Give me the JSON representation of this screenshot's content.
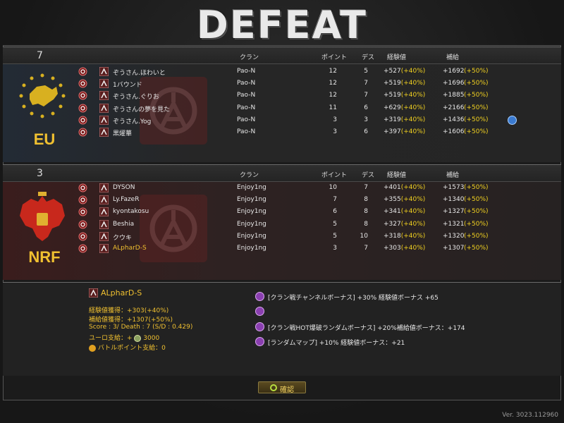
{
  "result_title": "DEFEAT",
  "headers": {
    "clan": "クラン",
    "points": "ポイント",
    "deaths": "デス",
    "exp": "経験値",
    "supply": "補給"
  },
  "teams": [
    {
      "name": "EU",
      "score": "7",
      "players": [
        {
          "name": "ぞうさん.ほわいと",
          "clan": "Pao-N",
          "points": "12",
          "deaths": "5",
          "exp": "+527",
          "exp_bonus": "(+40%)",
          "supply": "+1692",
          "supply_bonus": "(+50%)"
        },
        {
          "name": "1バウンド",
          "clan": "Pao-N",
          "points": "12",
          "deaths": "7",
          "exp": "+519",
          "exp_bonus": "(+40%)",
          "supply": "+1696",
          "supply_bonus": "(+50%)"
        },
        {
          "name": "ぞうさん.ぐりお",
          "clan": "Pao-N",
          "points": "12",
          "deaths": "7",
          "exp": "+519",
          "exp_bonus": "(+40%)",
          "supply": "+1885",
          "supply_bonus": "(+50%)"
        },
        {
          "name": "ぞうさんの夢を見た",
          "clan": "Pao-N",
          "points": "11",
          "deaths": "6",
          "exp": "+629",
          "exp_bonus": "(+40%)",
          "supply": "+2166",
          "supply_bonus": "(+50%)"
        },
        {
          "name": "ぞうさん.Yog",
          "clan": "Pao-N",
          "points": "3",
          "deaths": "3",
          "exp": "+319",
          "exp_bonus": "(+40%)",
          "supply": "+1436",
          "supply_bonus": "(+50%)"
        },
        {
          "name": "黒燿華",
          "clan": "Pao-N",
          "points": "3",
          "deaths": "6",
          "exp": "+397",
          "exp_bonus": "(+40%)",
          "supply": "+1606",
          "supply_bonus": "(+50%)"
        }
      ]
    },
    {
      "name": "NRF",
      "score": "3",
      "players": [
        {
          "name": "DYSON",
          "clan": "Enjoy1ng",
          "points": "10",
          "deaths": "7",
          "exp": "+401",
          "exp_bonus": "(+40%)",
          "supply": "+1573",
          "supply_bonus": "(+50%)"
        },
        {
          "name": "Ly.FazeR",
          "clan": "Enjoy1ng",
          "points": "7",
          "deaths": "8",
          "exp": "+355",
          "exp_bonus": "(+40%)",
          "supply": "+1340",
          "supply_bonus": "(+50%)"
        },
        {
          "name": "kyontakosu",
          "clan": "Enjoy1ng",
          "points": "6",
          "deaths": "8",
          "exp": "+341",
          "exp_bonus": "(+40%)",
          "supply": "+1327",
          "supply_bonus": "(+50%)"
        },
        {
          "name": "Beshia",
          "clan": "Enjoy1ng",
          "points": "5",
          "deaths": "8",
          "exp": "+327",
          "exp_bonus": "(+40%)",
          "supply": "+1321",
          "supply_bonus": "(+50%)"
        },
        {
          "name": "クウキ",
          "clan": "Enjoy1ng",
          "points": "5",
          "deaths": "10",
          "exp": "+318",
          "exp_bonus": "(+40%)",
          "supply": "+1320",
          "supply_bonus": "(+50%)"
        },
        {
          "name": "ALpharD-S",
          "clan": "Enjoy1ng",
          "points": "3",
          "deaths": "7",
          "exp": "+303",
          "exp_bonus": "(+40%)",
          "supply": "+1307",
          "supply_bonus": "(+50%)"
        }
      ]
    }
  ],
  "me": {
    "name": "ALpharD-S",
    "exp_line": "経験値獲得：+303(+40%)",
    "supply_line": "補給値獲得：+1307(+50%)",
    "score_line": "Score : 3/ Death : 7  (S/D : 0.429)",
    "euro_label": "ユーロ支給：+",
    "euro_value": "3000",
    "battle_points_line": "バトルポイント支給：0"
  },
  "bonuses": [
    "[クラン戦チャンネルボーナス] +30% 経験値ボーナス +65",
    "",
    "[クラン戦HOT爆破ランダムボーナス] +20%補給値ボーナス：+174",
    "[ランダムマップ] +10% 経験値ボーナス：+21"
  ],
  "confirm_label": "確認",
  "version": "Ver. 3023.112960",
  "colors": {
    "gold": "#f0c030",
    "bonus_yellow": "#f0d020",
    "eu_blue": "#232b35",
    "nrf_red": "#3a1d1d"
  }
}
